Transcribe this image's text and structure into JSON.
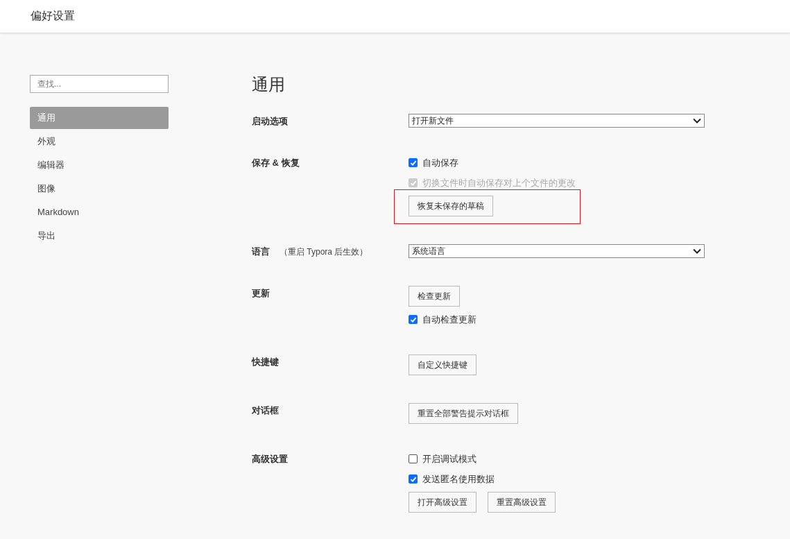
{
  "window": {
    "title": "偏好设置"
  },
  "sidebar": {
    "search": {
      "placeholder": "查找..."
    },
    "items": [
      {
        "label": "通用",
        "selected": true
      },
      {
        "label": "外观",
        "selected": false
      },
      {
        "label": "编辑器",
        "selected": false
      },
      {
        "label": "图像",
        "selected": false
      },
      {
        "label": "Markdown",
        "selected": false
      },
      {
        "label": "导出",
        "selected": false
      }
    ]
  },
  "page": {
    "title": "通用",
    "sections": [
      {
        "label": "启动选项",
        "items": [
          {
            "kind": "select",
            "value": "打开新文件"
          }
        ]
      },
      {
        "label": "保存 & 恢复",
        "items": [
          {
            "kind": "checkbox",
            "label": "自动保存",
            "checked": true,
            "disabled": false
          },
          {
            "kind": "checkbox",
            "label": "切换文件时自动保存对上个文件的更改",
            "checked": true,
            "disabled": true
          },
          {
            "kind": "buttons",
            "buttons": [
              {
                "label": "恢复未保存的草稿",
                "highlighted": true
              }
            ]
          }
        ]
      },
      {
        "label": "语言",
        "note": "（重启 Typora 后生效）",
        "items": [
          {
            "kind": "select",
            "value": "系统语言"
          }
        ]
      },
      {
        "label": "更新",
        "items": [
          {
            "kind": "buttons",
            "buttons": [
              {
                "label": "检查更新",
                "highlighted": false
              }
            ]
          },
          {
            "kind": "checkbox",
            "label": "自动检查更新",
            "checked": true,
            "disabled": false
          }
        ]
      },
      {
        "label": "快捷键",
        "items": [
          {
            "kind": "buttons",
            "buttons": [
              {
                "label": "自定义快捷键",
                "highlighted": false
              }
            ]
          }
        ]
      },
      {
        "label": "对话框",
        "items": [
          {
            "kind": "buttons",
            "buttons": [
              {
                "label": "重置全部警告提示对话框",
                "highlighted": false
              }
            ]
          }
        ]
      },
      {
        "label": "高级设置",
        "items": [
          {
            "kind": "checkbox",
            "label": "开启调试模式",
            "checked": false,
            "disabled": false
          },
          {
            "kind": "checkbox",
            "label": "发送匿名使用数据",
            "checked": true,
            "disabled": false
          },
          {
            "kind": "buttons",
            "buttons": [
              {
                "label": "打开高级设置",
                "highlighted": false
              },
              {
                "label": "重置高级设置",
                "highlighted": false
              }
            ]
          }
        ]
      }
    ]
  }
}
